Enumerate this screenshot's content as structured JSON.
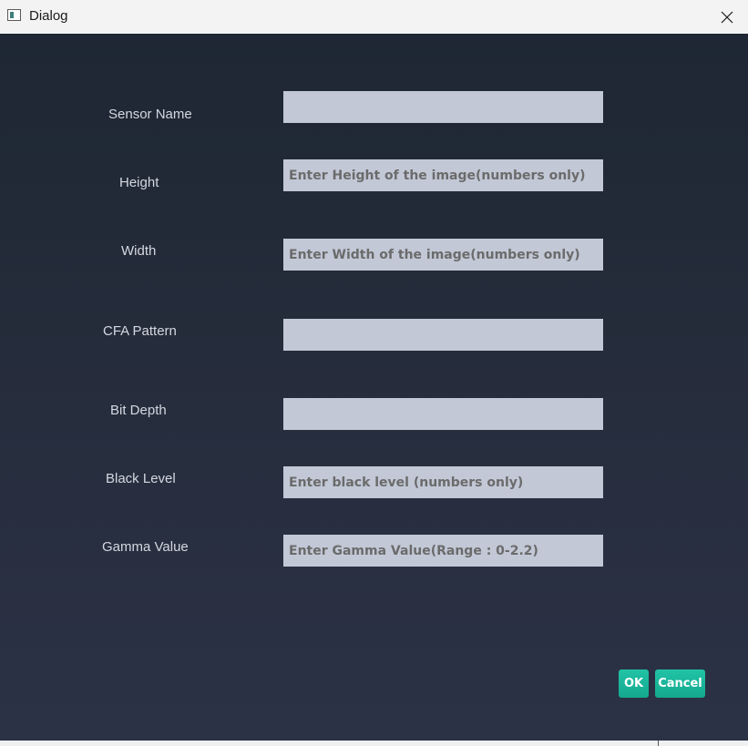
{
  "window": {
    "title": "Dialog"
  },
  "form": {
    "fields": [
      {
        "label": "Sensor Name",
        "value": "",
        "placeholder": ""
      },
      {
        "label": "Height",
        "value": "",
        "placeholder": "Enter Height of the image(numbers only)"
      },
      {
        "label": "Width",
        "value": "",
        "placeholder": "Enter Width of the image(numbers only)"
      },
      {
        "label": "CFA Pattern",
        "value": "",
        "placeholder": ""
      },
      {
        "label": "Bit Depth",
        "value": "",
        "placeholder": ""
      },
      {
        "label": "Black Level",
        "value": "",
        "placeholder": "Enter black level (numbers only)"
      },
      {
        "label": "Gamma Value",
        "value": "",
        "placeholder": "Enter Gamma Value(Range : 0-2.2)"
      }
    ]
  },
  "buttons": {
    "ok_label": "OK",
    "cancel_label": "Cancel"
  },
  "colors": {
    "titlebar": "#f3f3f3",
    "background_top": "#1e2733",
    "background_bottom": "#2c3246",
    "field_bg": "#c2c8d6",
    "accent": "#1bb89c",
    "label_text": "#d4d8e0"
  },
  "icons": {
    "app": "app-window-icon",
    "close": "close-icon"
  }
}
